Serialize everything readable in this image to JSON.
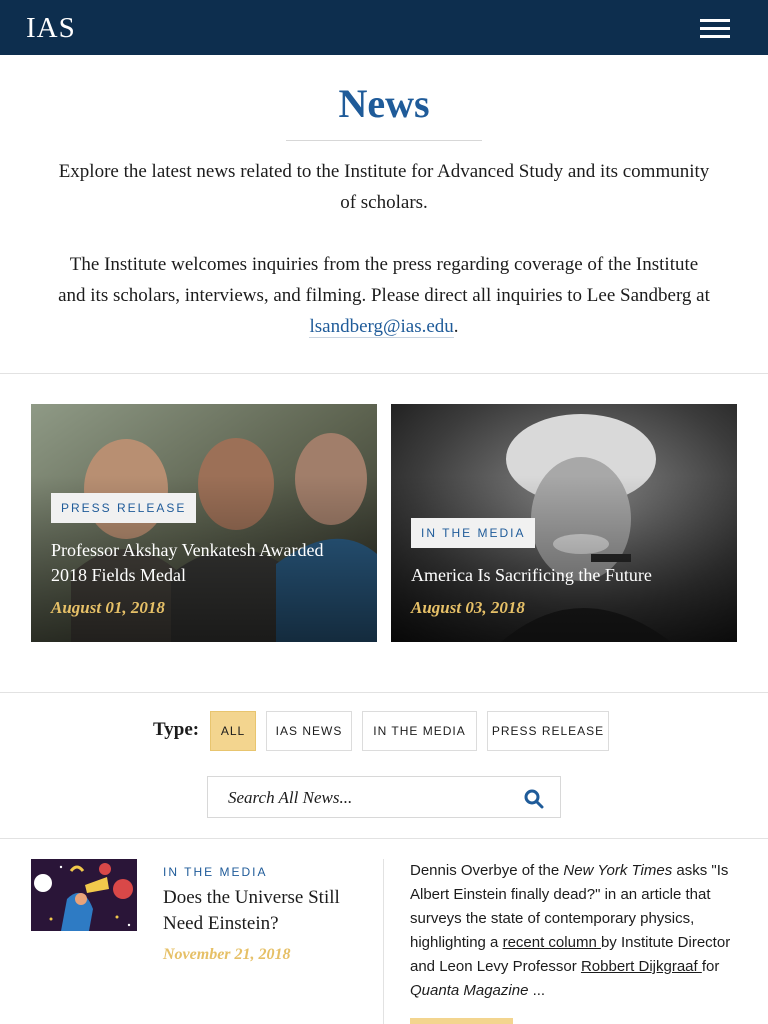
{
  "header": {
    "logo": "IAS"
  },
  "page": {
    "title": "News",
    "intro": "Explore the latest news related to the Institute for Advanced Study and its community of scholars.",
    "inquiry_text": "The Institute welcomes inquiries from the press regarding coverage of the Institute and its scholars, interviews, and filming. Please direct all inquiries to Lee Sandberg at",
    "inquiry_email": "lsandberg@ias.edu",
    "inquiry_end": "."
  },
  "featured": [
    {
      "tag": "PRESS RELEASE",
      "title": "Professor Akshay Venkatesh Awarded 2018 Fields Medal",
      "date": "August 01, 2018"
    },
    {
      "tag": "IN THE MEDIA",
      "title": "America Is Sacrificing the Future",
      "date": "August 03, 2018"
    }
  ],
  "filters": {
    "label": "Type:",
    "options": [
      "ALL",
      "IAS NEWS",
      "IN THE MEDIA",
      "PRESS RELEASE"
    ],
    "selected": "ALL"
  },
  "search": {
    "placeholder": "Search All News..."
  },
  "articles": [
    {
      "tag": "IN THE MEDIA",
      "title": "Does the Universe Still Need Einstein?",
      "date": "November 21, 2018",
      "excerpt": {
        "p1": "Dennis Overbye of the ",
        "publication": "New York Times",
        "p2": " asks \"Is Albert Einstein finally dead?\" in an article that surveys the state of contemporary physics, highlighting a ",
        "link1": "recent column ",
        "p3": "by Institute Director and Leon Levy Professor ",
        "link2": "Robbert Dijkgraaf ",
        "p4": "for ",
        "magazine": "Quanta Magazine",
        "p5": " ..."
      }
    }
  ],
  "colors": {
    "navy": "#0d2e4e",
    "accent_blue": "#1f5b99",
    "gold": "#e6c067",
    "active_filter": "#f3d58f"
  }
}
